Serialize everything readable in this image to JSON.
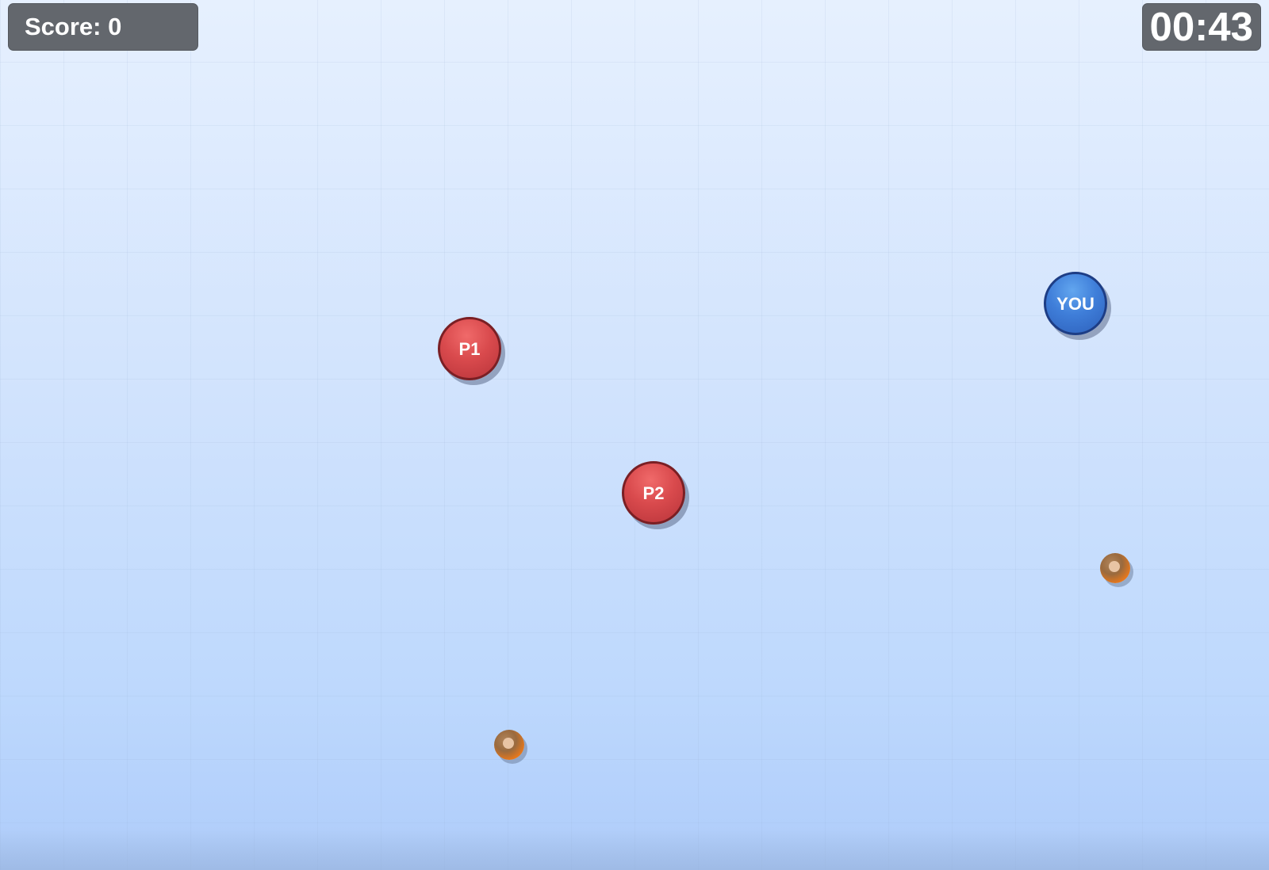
{
  "hud": {
    "score_text": "Score: 0",
    "timer_text": "00:43"
  },
  "players": [
    {
      "label": "P1",
      "team": "red"
    },
    {
      "label": "P2",
      "team": "red"
    },
    {
      "label": "YOU",
      "team": "blue"
    }
  ],
  "coins": [
    {
      "kind": "coin"
    },
    {
      "kind": "coin"
    }
  ],
  "colors": {
    "hud_background": "#63676d",
    "red_token": "#d94a4d",
    "red_token_border": "#7a1f24",
    "blue_token": "#3f7ed9",
    "blue_token_border": "#1d3d85",
    "coin": "#e8781c",
    "board_top": "#e6f0fe",
    "board_bottom": "#b2cffb"
  }
}
